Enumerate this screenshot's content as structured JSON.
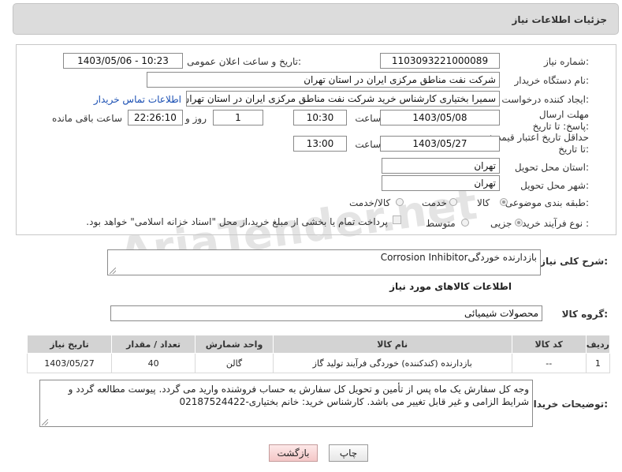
{
  "header": {
    "title": "جزئیات اطلاعات نیاز"
  },
  "form": {
    "need_number": {
      "label": "شماره نیاز:",
      "value": "1103093221000089"
    },
    "announce_datetime": {
      "label": "تاریخ و ساعت اعلان عمومی:",
      "value": "1403/05/06 - 10:23"
    },
    "buyer_org": {
      "label": "نام دستگاه خریدار:",
      "value": "شرکت نفت مناطق مرکزی ایران در استان تهران"
    },
    "requester": {
      "label": "ایجاد کننده درخواست:",
      "value": "سمیرا بختیاری کارشناس خرید شرکت نفت مناطق مرکزی ایران در استان تهران",
      "contact_link": "اطلاعات تماس خریدار"
    },
    "deadline": {
      "label": "مهلت ارسال پاسخ: تا تاریخ:",
      "date": "1403/05/08",
      "time_label": "ساعت",
      "time": "10:30",
      "days": "1",
      "days_label": "روز و",
      "remaining": "22:26:10",
      "remaining_label": "ساعت باقی مانده"
    },
    "price_validity": {
      "label": "حداقل تاریخ اعتبار قیمت: تا تاریخ:",
      "date": "1403/05/27",
      "time_label": "ساعت",
      "time": "13:00"
    },
    "delivery_province": {
      "label": "استان محل تحویل:",
      "value": "تهران"
    },
    "delivery_city": {
      "label": "شهر محل تحویل:",
      "value": "تهران"
    },
    "category": {
      "label": "طبقه بندی موضوعی:",
      "options": [
        "کالا",
        "خدمت",
        "کالا/خدمت"
      ]
    },
    "process_type": {
      "label": "نوع فرآیند خرید :",
      "options": [
        "جزیی",
        "متوسط"
      ],
      "payment_note": "پرداخت تمام یا بخشی از مبلغ خرید،از محل \"اسناد خزانه اسلامی\" خواهد بود."
    }
  },
  "summary": {
    "label": "شرح کلی نیاز:",
    "value": "Corrosion Inhibitorبازدارنده خوردگی"
  },
  "goods_section": {
    "title": "اطلاعات کالاهای مورد نیاز"
  },
  "goods_group": {
    "label": "گروه کالا:",
    "value": "محصولات شیمیائی"
  },
  "table": {
    "headers": [
      "ردیف",
      "کد کالا",
      "نام کالا",
      "واحد شمارش",
      "تعداد / مقدار",
      "تاریخ نیاز"
    ],
    "rows": [
      [
        "1",
        "--",
        "بازدارنده (کندکننده) خوردگی فرآیند تولید گاز",
        "گالن",
        "40",
        "1403/05/27"
      ]
    ]
  },
  "buyer_notes": {
    "label": "توضیحات خریدار:",
    "value": "وجه کل سفارش یک ماه پس از تأمین و تحویل کل سفارش به حساب فروشنده وارید می گردد. پیوست مطالعه گردد و شرایط الزامی و غیر قابل تغییر می باشد. کارشناس خرید: خانم بختیاری-02187524422"
  },
  "buttons": {
    "print": "چاپ",
    "back": "بازگشت"
  },
  "watermark": "AriaTender.net",
  "colors": {
    "link": "#1a4fb3",
    "header_bg": "#dcdcdc",
    "table_header_bg": "#d3d3d3"
  }
}
